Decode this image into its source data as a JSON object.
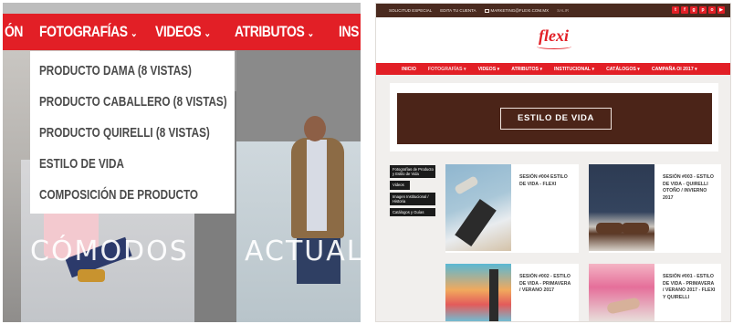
{
  "left_panel": {
    "nav": [
      {
        "label": "ÓN"
      },
      {
        "label": "FOTOGRAFÍAS",
        "chevron": "chevron-down-icon"
      },
      {
        "label": "VIDEOS",
        "chevron": "chevron-down-icon"
      },
      {
        "label": "ATRIBUTOS",
        "chevron": "chevron-down-icon"
      },
      {
        "label": "INS"
      }
    ],
    "dropdown": [
      "PRODUCTO DAMA (8 VISTAS)",
      "PRODUCTO CABALLERO (8 VISTAS)",
      "PRODUCTO QUIRELLI (8 VISTAS)",
      "ESTILO DE VIDA",
      "COMPOSICIÓN DE PRODUCTO"
    ],
    "overlays": [
      "CÓMODOS",
      "ACTUAL"
    ]
  },
  "right_panel": {
    "topbar": {
      "links": [
        "SOLICITUD ESPECIAL",
        "EDITA TU CUENTA"
      ],
      "email": "MARKETING@FLEXI.COM.MX",
      "exit": "SALIR"
    },
    "social_icons": [
      {
        "name": "twitter-icon",
        "glyph": "t"
      },
      {
        "name": "facebook-icon",
        "glyph": "f"
      },
      {
        "name": "google-plus-icon",
        "glyph": "g"
      },
      {
        "name": "pinterest-icon",
        "glyph": "p"
      },
      {
        "name": "instagram-icon",
        "glyph": "o"
      },
      {
        "name": "youtube-icon",
        "glyph": "▶"
      }
    ],
    "logo": "flexi",
    "nav": [
      "INICIO",
      "FOTOGRAFÍAS ▾",
      "VIDEOS ▾",
      "ATRIBUTOS ▾",
      "INSTITUCIONAL ▾",
      "CATÁLOGOS ▾",
      "CAMPAÑA OI 2017 ▾"
    ],
    "banner_title": "ESTILO DE VIDA",
    "side_menu": [
      "Fotografías de Producto y Estilo de Vida",
      "Videos",
      "Imagen Institucional / Historia",
      "Catálogos y Guías"
    ],
    "posts": [
      "SESIÓN #004 ESTILO DE VIDA - FLEXI",
      "SESIÓN #003 - ESTILO DE VIDA - QUIRELLI OTOÑO / INVIERNO 2017",
      "SESIÓN #002 - ESTILO DE VIDA - PRIMAVERA / VERANO 2017",
      "SESIÓN #001 - ESTILO DE VIDA - PRIMAVERA / VERANO 2017 - FLEXI Y QUIRELLI"
    ]
  },
  "colors": {
    "brand_red": "#e21f26",
    "brand_brown": "#4b2418",
    "topbar_brown": "#4a2a1f",
    "dropdown_text": "#4a4a4a"
  }
}
